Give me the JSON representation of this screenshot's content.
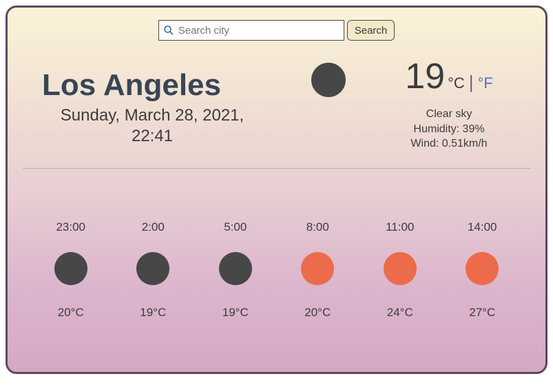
{
  "search": {
    "placeholder": "Search city",
    "button": "Search"
  },
  "current": {
    "city": "Los Angeles",
    "date": "Sunday, March 28, 2021, 22:41",
    "icon_color": "dark",
    "temp": "19",
    "unit_c": "°C",
    "separator": "|",
    "unit_f": "°F",
    "condition": "Clear sky",
    "humidity": "Humidity: 39%",
    "wind": "Wind: 0.51km/h"
  },
  "forecast": [
    {
      "time": "23:00",
      "icon": "dark",
      "temp": "20°C"
    },
    {
      "time": "2:00",
      "icon": "dark",
      "temp": "19°C"
    },
    {
      "time": "5:00",
      "icon": "dark",
      "temp": "19°C"
    },
    {
      "time": "8:00",
      "icon": "orange",
      "temp": "20°C"
    },
    {
      "time": "11:00",
      "icon": "orange",
      "temp": "24°C"
    },
    {
      "time": "14:00",
      "icon": "orange",
      "temp": "27°C"
    }
  ]
}
